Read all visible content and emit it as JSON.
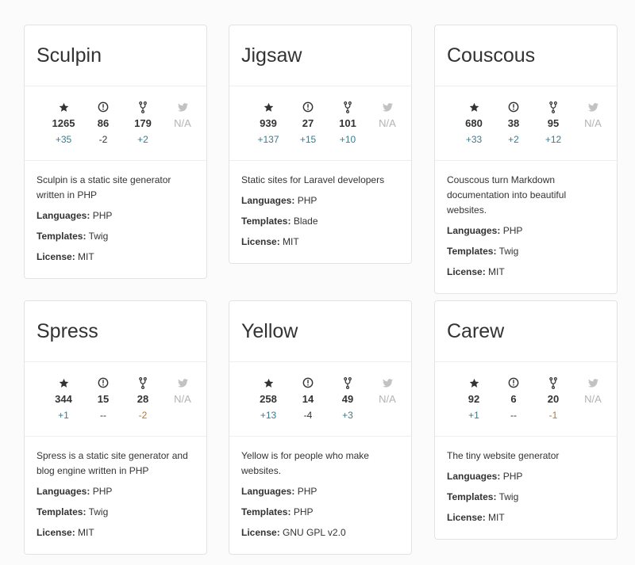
{
  "labels": {
    "languages": "Languages:",
    "templates": "Templates:",
    "license": "License:"
  },
  "colors": {
    "positive": "#3d7a8a",
    "negative_fork": "#b5782c",
    "muted": "#b3b3b3",
    "border": "#e3e3e3"
  },
  "icons": [
    "star-icon",
    "issue-icon",
    "fork-icon",
    "twitter-icon"
  ],
  "cards": [
    {
      "title": "Sculpin",
      "stars": "1265",
      "stars_delta": "+35",
      "issues": "86",
      "issues_delta": "-2",
      "forks": "179",
      "forks_delta": "+2",
      "twitter": "N/A",
      "description": "Sculpin is a static site generator written in PHP",
      "languages": "PHP",
      "templates": "Twig",
      "license": "MIT"
    },
    {
      "title": "Jigsaw",
      "stars": "939",
      "stars_delta": "+137",
      "issues": "27",
      "issues_delta": "+15",
      "forks": "101",
      "forks_delta": "+10",
      "twitter": "N/A",
      "description": "Static sites for Laravel developers",
      "languages": "PHP",
      "templates": "Blade",
      "license": "MIT"
    },
    {
      "title": "Couscous",
      "stars": "680",
      "stars_delta": "+33",
      "issues": "38",
      "issues_delta": "+2",
      "forks": "95",
      "forks_delta": "+12",
      "twitter": "N/A",
      "description": "Couscous turn Markdown documentation into beautiful websites.",
      "languages": "PHP",
      "templates": "Twig",
      "license": "MIT"
    },
    {
      "title": "Spress",
      "stars": "344",
      "stars_delta": "+1",
      "issues": "15",
      "issues_delta": "--",
      "forks": "28",
      "forks_delta": "-2",
      "twitter": "N/A",
      "description": "Spress is a static site generator and blog engine written in PHP",
      "languages": "PHP",
      "templates": "Twig",
      "license": "MIT"
    },
    {
      "title": "Yellow",
      "stars": "258",
      "stars_delta": "+13",
      "issues": "14",
      "issues_delta": "-4",
      "forks": "49",
      "forks_delta": "+3",
      "twitter": "N/A",
      "description": "Yellow is for people who make websites.",
      "languages": "PHP",
      "templates": "PHP",
      "license": "GNU GPL v2.0"
    },
    {
      "title": "Carew",
      "stars": "92",
      "stars_delta": "+1",
      "issues": "6",
      "issues_delta": "--",
      "forks": "20",
      "forks_delta": "-1",
      "twitter": "N/A",
      "description": "The tiny website generator",
      "languages": "PHP",
      "templates": "Twig",
      "license": "MIT"
    }
  ]
}
